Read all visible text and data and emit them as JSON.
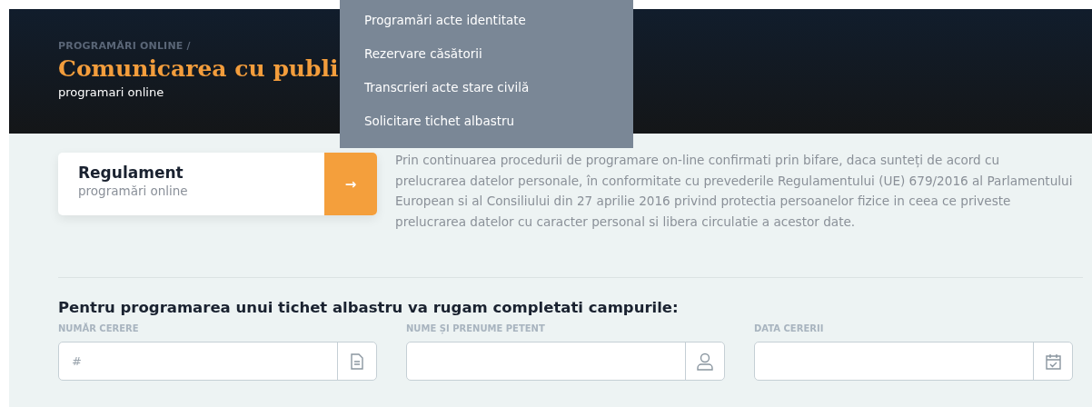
{
  "header": {
    "breadcrumb": "PROGRAMĂRI ONLINE /",
    "title": "Comunicarea cu publi",
    "subtitle": "programari online"
  },
  "dropdown": {
    "items": [
      {
        "label": "Programări acte identitate"
      },
      {
        "label": "Rezervare căsătorii"
      },
      {
        "label": "Transcrieri acte stare civilă"
      },
      {
        "label": "Solicitare tichet albastru"
      }
    ]
  },
  "regulament_card": {
    "title": "Regulament",
    "subtitle": "programări online",
    "button": "→"
  },
  "consent_text": "Prin continuarea procedurii de programare on-line confirmati prin bifare, daca sunteți de acord cu prelucrarea datelor personale, în conformitate cu prevederile Regulamentului (UE) 679/2016 al Parlamentului European si al Consiliului din 27 aprilie 2016 privind protectia persoanelor fizice in ceea ce priveste prelucrarea datelor cu caracter personal si libera circulatie a acestor date.",
  "form": {
    "heading": "Pentru programarea unui tichet albastru va rugam completati campurile:",
    "fields": [
      {
        "label": "NUMĂR CERERE",
        "placeholder": "#",
        "kind": "document"
      },
      {
        "label": "NUME ȘI PRENUME PETENT",
        "kind": "person"
      },
      {
        "label": "DATA CERERII",
        "kind": "calendar"
      }
    ]
  }
}
